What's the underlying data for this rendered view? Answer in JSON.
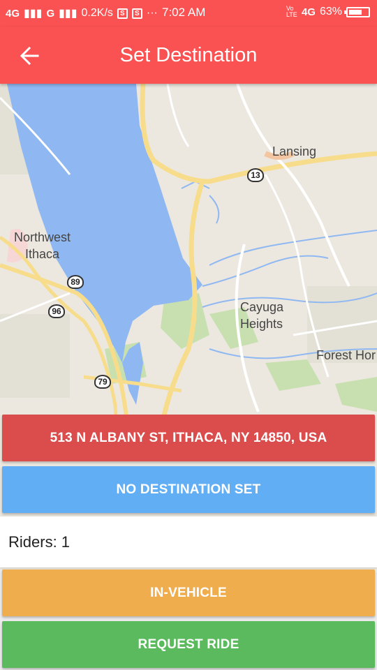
{
  "status_bar": {
    "signal_1": "4G",
    "signal_2": "G",
    "speed": "0.2K/s",
    "time": "7:02 AM",
    "volte": "Vo LTE",
    "network": "4G",
    "battery": "63%"
  },
  "app_bar": {
    "title": "Set Destination",
    "back_icon": "arrow-left-icon"
  },
  "map": {
    "labels": {
      "lansing": "Lansing",
      "northwest_ithaca": "Northwest\nIthaca",
      "cayuga_heights": "Cayuga\nHeights",
      "forest_home": "Forest Hor"
    },
    "shields": {
      "r13": "13",
      "r89": "89",
      "r96": "96",
      "r79": "79"
    }
  },
  "buttons": {
    "origin": "513 N ALBANY ST, ITHACA, NY 14850, USA",
    "destination": "NO DESTINATION SET",
    "in_vehicle": "IN-VEHICLE",
    "request_ride": "REQUEST RIDE"
  },
  "riders": {
    "label": "Riders: 1"
  },
  "colors": {
    "primary": "#fa5252",
    "origin_button": "#db4d4d",
    "destination_button": "#62aef5",
    "in_vehicle_button": "#f0ad4e",
    "request_button": "#5bb95e",
    "water": "#8fb8f2",
    "road": "#f7dd8b",
    "park": "#c8e0b0"
  }
}
